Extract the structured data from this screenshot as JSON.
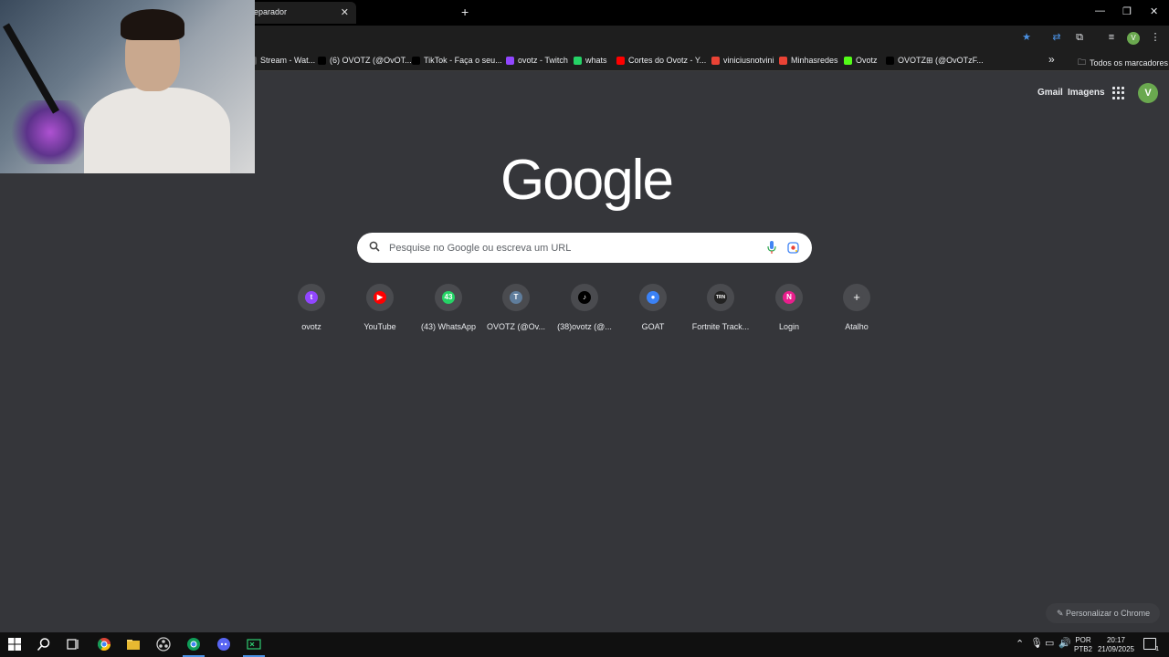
{
  "tab": {
    "title": "eparador",
    "close": "✕"
  },
  "new_tab": "+",
  "window_controls": {
    "minimize": "—",
    "restore": "❐",
    "close": "✕"
  },
  "bookmarks": [
    {
      "label": "Stream - Wat...",
      "icon": "generic-icon",
      "color": "#555555"
    },
    {
      "label": "(6) OVOTZ (@OvOT...",
      "icon": "x-icon",
      "color": "#000000"
    },
    {
      "label": "TikTok - Faça o seu...",
      "icon": "tiktok-icon",
      "color": "#000000"
    },
    {
      "label": "ovotz - Twitch",
      "icon": "twitch-icon",
      "color": "#9146ff"
    },
    {
      "label": "whats",
      "icon": "whatsapp-icon",
      "color": "#25d366"
    },
    {
      "label": "Cortes do Ovotz - Y...",
      "icon": "youtube-icon",
      "color": "#ff0000"
    },
    {
      "label": "viniciusnotvini",
      "icon": "gmail-icon",
      "color": "#ea4335"
    },
    {
      "label": "Minhasredes",
      "icon": "gmail-icon",
      "color": "#ea4335"
    },
    {
      "label": "Ovotz",
      "icon": "kick-icon",
      "color": "#53fc18"
    },
    {
      "label": "OVOTZ⊞ (@OvOTzF...",
      "icon": "x-icon",
      "color": "#000000"
    }
  ],
  "bookmarks_overflow": "»",
  "all_bookmarks": "Todos os marcadores",
  "header": {
    "gmail": "Gmail",
    "images": "Imagens",
    "avatar_letter": "V"
  },
  "logo": "Google",
  "search": {
    "placeholder": "Pesquise no Google ou escreva um URL"
  },
  "shortcuts": [
    {
      "label": "ovotz",
      "icon": "twitch-icon",
      "color": "#9146ff",
      "glyph": "t"
    },
    {
      "label": "YouTube",
      "icon": "youtube-icon",
      "color": "#ff0000",
      "glyph": "▶"
    },
    {
      "label": "(43) WhatsApp",
      "icon": "whatsapp-icon",
      "color": "#25d366",
      "glyph": "43"
    },
    {
      "label": "OVOTZ (@Ov...",
      "icon": "letter-t-icon",
      "color": "#5f7d9c",
      "glyph": "T"
    },
    {
      "label": "(38)ovotz (@...",
      "icon": "tiktok-icon",
      "color": "#000000",
      "glyph": "♪"
    },
    {
      "label": "GOAT",
      "icon": "goat-icon",
      "color": "#3b82f6",
      "glyph": "●"
    },
    {
      "label": "Fortnite Track...",
      "icon": "tracker-icon",
      "color": "#222222",
      "glyph": "TRN"
    },
    {
      "label": "Login",
      "icon": "letter-n-icon",
      "color": "#e91e8c",
      "glyph": "N"
    },
    {
      "label": "Atalho",
      "icon": "add-icon",
      "color": "#4a4b4f",
      "glyph": "+"
    }
  ],
  "customize_chrome": "Personalizar o Chrome",
  "taskbar": {
    "language": "POR",
    "layout": "PTB2",
    "time": "20:17",
    "date": "21/09/2025",
    "notifications": "1"
  }
}
